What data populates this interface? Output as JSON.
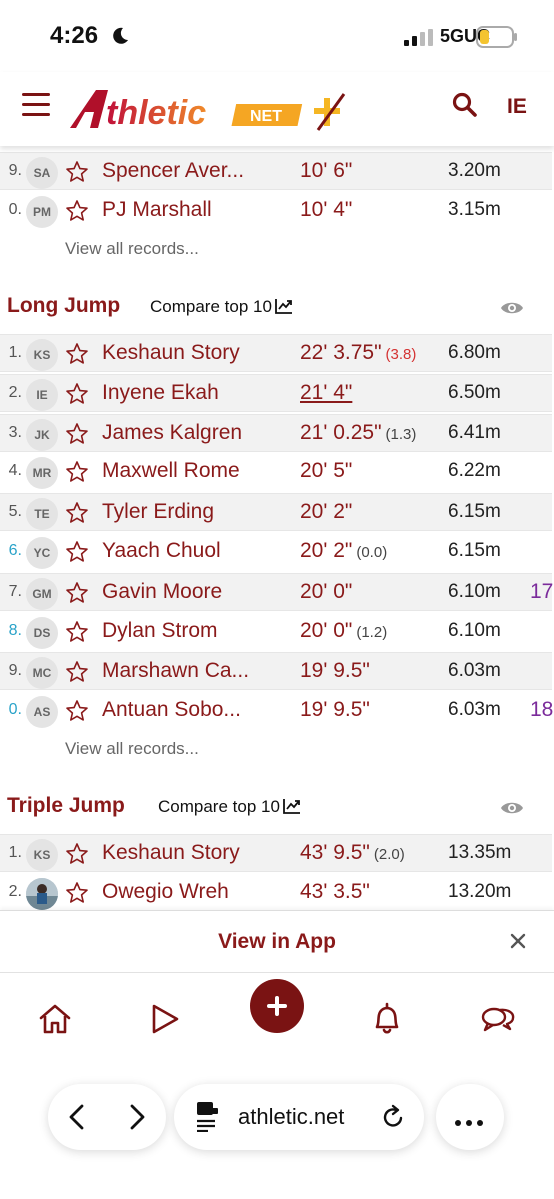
{
  "status_bar": {
    "time": "4:26",
    "network": "5GUC"
  },
  "header": {
    "logo_text": "thletic",
    "logo_net": "NET",
    "user_initials": "IE"
  },
  "pole_vault_tail": {
    "rows": [
      {
        "rank": "9.",
        "initials": "SA",
        "name": "Spencer Aver...",
        "mark": "10' 6\"",
        "wind": "",
        "metric": "3.20m",
        "extra": ""
      },
      {
        "rank": "0.",
        "initials": "PM",
        "name": "PJ Marshall",
        "mark": "10' 4\"",
        "wind": "",
        "metric": "3.15m",
        "extra": ""
      }
    ],
    "view_all": "View all records..."
  },
  "long_jump": {
    "title": "Long Jump",
    "compare": "Compare top 10",
    "rows": [
      {
        "rank": "1.",
        "initials": "KS",
        "name": "Keshaun Story",
        "mark": "22' 3.75\"",
        "wind": "(3.8)",
        "metric": "6.80m",
        "extra": ""
      },
      {
        "rank": "2.",
        "initials": "IE",
        "name": "Inyene Ekah",
        "mark": "21' 4\"",
        "wind": "",
        "metric": "6.50m",
        "extra": ""
      },
      {
        "rank": "3.",
        "initials": "JK",
        "name": "James Kalgren",
        "mark": "21' 0.25\"",
        "wind": "(1.3)",
        "metric": "6.41m",
        "extra": ""
      },
      {
        "rank": "4.",
        "initials": "MR",
        "name": "Maxwell Rome",
        "mark": "20' 5\"",
        "wind": "",
        "metric": "6.22m",
        "extra": ""
      },
      {
        "rank": "5.",
        "initials": "TE",
        "name": "Tyler Erding",
        "mark": "20' 2\"",
        "wind": "",
        "metric": "6.15m",
        "extra": ""
      },
      {
        "rank": "6.",
        "initials": "YC",
        "name": "Yaach Chuol",
        "mark": "20' 2\"",
        "wind": "(0.0)",
        "metric": "6.15m",
        "extra": ""
      },
      {
        "rank": "7.",
        "initials": "GM",
        "name": "Gavin Moore",
        "mark": "20' 0\"",
        "wind": "",
        "metric": "6.10m",
        "extra": "17"
      },
      {
        "rank": "8.",
        "initials": "DS",
        "name": "Dylan Strom",
        "mark": "20' 0\"",
        "wind": "(1.2)",
        "metric": "6.10m",
        "extra": ""
      },
      {
        "rank": "9.",
        "initials": "MC",
        "name": "Marshawn Ca...",
        "mark": "19' 9.5\"",
        "wind": "",
        "metric": "6.03m",
        "extra": ""
      },
      {
        "rank": "0.",
        "initials": "AS",
        "name": "Antuan Sobo...",
        "mark": "19' 9.5\"",
        "wind": "",
        "metric": "6.03m",
        "extra": "18"
      }
    ],
    "view_all": "View all records..."
  },
  "triple_jump": {
    "title": "Triple Jump",
    "compare": "Compare top 10",
    "rows": [
      {
        "rank": "1.",
        "initials": "KS",
        "name": "Keshaun Story",
        "mark": "43' 9.5\"",
        "wind": "(2.0)",
        "metric": "13.35m",
        "extra": ""
      },
      {
        "rank": "2.",
        "initials": "",
        "name": "Owegio Wreh",
        "mark": "43' 3.5\"",
        "wind": "",
        "metric": "13.20m",
        "extra": ""
      }
    ]
  },
  "app_banner": {
    "label": "View in App"
  },
  "browser": {
    "url": "athletic.net"
  },
  "colors": {
    "brand": "#7a1313",
    "link": "#8a1a1a",
    "wind_red": "#d43232",
    "rank_teal": "#2aa3c9",
    "purple": "#7b2b9b"
  },
  "icons": [
    "moon-icon",
    "signal-icon",
    "battery-icon",
    "menu-icon",
    "search-icon",
    "star-icon",
    "chart-icon",
    "eye-icon",
    "close-icon",
    "home-icon",
    "play-icon",
    "add-icon",
    "bell-icon",
    "chat-icon",
    "back-icon",
    "forward-icon",
    "page-icon",
    "reload-icon",
    "more-icon"
  ]
}
